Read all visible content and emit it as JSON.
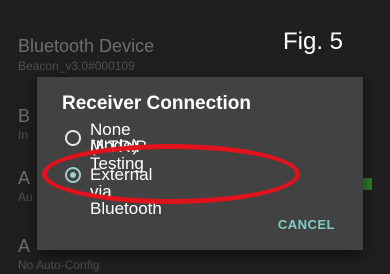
{
  "background": {
    "rows": [
      {
        "title": "Bluetooth Device",
        "subtitle": "Beacon_v3.0#000109"
      },
      {
        "title": "B",
        "subtitle": "In"
      },
      {
        "title": "A",
        "subtitle": "Au"
      },
      {
        "title": "A",
        "subtitle": "No Auto-Config"
      }
    ]
  },
  "figure_label": "Fig. 5",
  "dialog": {
    "title": "Receiver Connection",
    "options": [
      {
        "line1": "None (NTRIP Testing",
        "line2": "Mode)",
        "selected": false
      },
      {
        "label": "External via Bluetooth",
        "selected": true
      }
    ],
    "cancel_label": "CANCEL"
  },
  "colors": {
    "accent": "#80cbc4",
    "dialog_bg": "#424242",
    "annotation": "#e0121b"
  }
}
